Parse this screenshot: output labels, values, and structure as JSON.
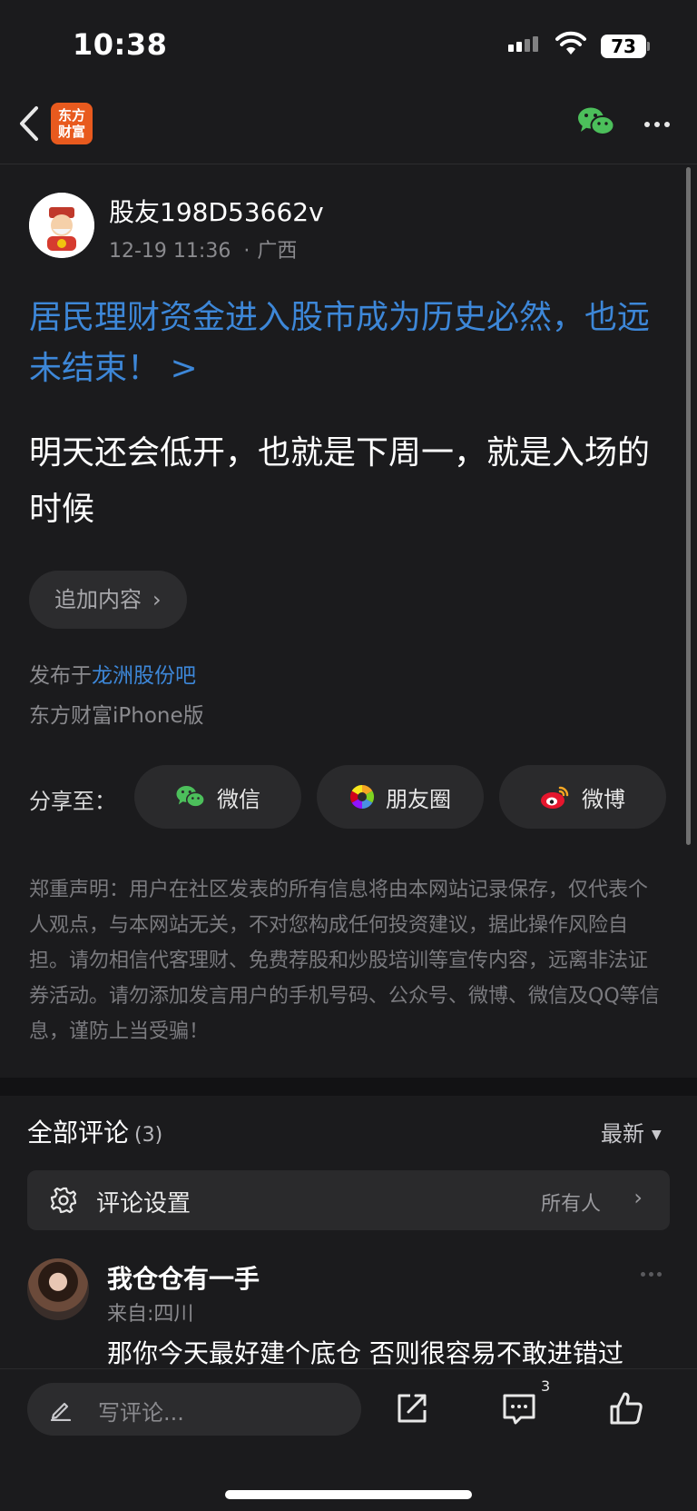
{
  "status_bar": {
    "time": "10:38",
    "battery": "73"
  },
  "nav": {
    "logo_line1": "东方",
    "logo_line2": "财富"
  },
  "post": {
    "author": "股友198D53662v",
    "date": "12-19 11:36",
    "location": "广西",
    "headline": "居民理财资金进入股市成为历史必然，也远未结束！ >",
    "body": "明天还会低开，也就是下周一，就是入场的时候",
    "append_label": "追加内容",
    "published_prefix": "发布于",
    "bar_name": "龙洲股份吧",
    "platform": "东方财富iPhone版"
  },
  "share": {
    "label": "分享至：",
    "wechat": "微信",
    "moments": "朋友圈",
    "weibo": "微博"
  },
  "disclaimer": "郑重声明：用户在社区发表的所有信息将由本网站记录保存，仅代表个人观点，与本网站无关，不对您构成任何投资建议，据此操作风险自担。请勿相信代客理财、免费荐股和炒股培训等宣传内容，远离非法证券活动。请勿添加发言用户的手机号码、公众号、微博、微信及QQ等信息，谨防上当受骗！",
  "comments": {
    "title": "全部评论",
    "count": "(3)",
    "sort": "最新",
    "settings_label": "评论设置",
    "settings_value": "所有人",
    "items": [
      {
        "name": "我仓仓有一手",
        "from": "来自:四川",
        "text": "那你今天最好建个底仓 否则很容易不敢进错过"
      }
    ]
  },
  "bottom_bar": {
    "placeholder": "写评论...",
    "comment_badge": "3"
  },
  "colors": {
    "link": "#3d87d8",
    "background": "#1b1b1d",
    "logo": "#e85a1e",
    "wechat_green": "#4cbf5b"
  }
}
